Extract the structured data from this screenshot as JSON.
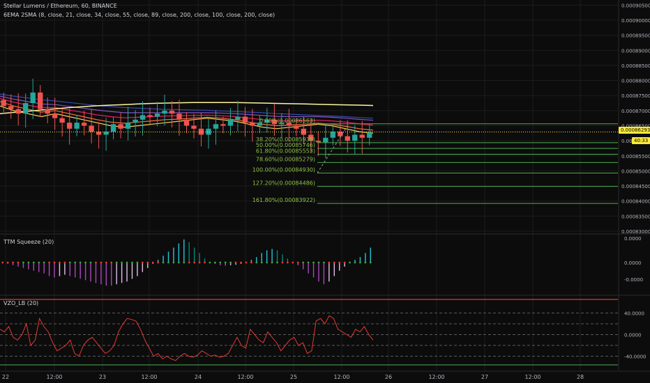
{
  "header": {
    "symbol_line": "Stellar Lumens / Ethereum, 60, BINANCE",
    "study_line": "6EMA 2SMA (8, close, 21, close, 34, close, 55, close, 89, close, 200, close, 100, close, 200, close)"
  },
  "panes": {
    "squeeze_label": "TTM Squeeze (20)",
    "vzo_label": "VZO_LB (20)"
  },
  "tags": {
    "last_price": "0.00086293",
    "countdown": "40:33"
  },
  "colors": {
    "background": "#0c0c0c",
    "grid": "#1c1c1c",
    "up_candle": "#26a69a",
    "down_candle": "#ef5350",
    "fib_line": "#4caf50",
    "fib_text": "#8bc34a",
    "price_tag_bg": "#ffeb3b",
    "vzo_line": "#e53935"
  },
  "chart_data": [
    {
      "type": "candlestick",
      "title": "Stellar Lumens / Ethereum, 60, BINANCE",
      "price_axis": [
        "0.00090500",
        "0.00090000",
        "0.00089500",
        "0.00089000",
        "0.00088500",
        "0.00088000",
        "0.00087500",
        "0.00087000",
        "0.00086500",
        "0.00086000",
        "0.00085500",
        "0.00085000",
        "0.00084500",
        "0.00084000",
        "0.00083500",
        "0.00083000"
      ],
      "time_axis": [
        "22",
        "12:00",
        "23",
        "12:00",
        "24",
        "12:00",
        "25",
        "12:00",
        "26",
        "12:00",
        "27",
        "12:00",
        "28"
      ],
      "ylim": [
        0.00083,
        0.000906
      ],
      "last_price": 0.00086293,
      "fib_levels": [
        {
          "label": "0.00%(0.00086563)",
          "value": 0.00086563
        },
        {
          "label": "38.20%(0.00085938)",
          "value": 0.00085938
        },
        {
          "label": "50.00%(0.00085746)",
          "value": 0.00085746
        },
        {
          "label": "61.80%(0.00085553)",
          "value": 0.00085553
        },
        {
          "label": "78.60%(0.00085279)",
          "value": 0.00085279
        },
        {
          "label": "100.00%(0.00084930)",
          "value": 0.0008493
        },
        {
          "label": "127.20%(0.00084486)",
          "value": 0.00084486
        },
        {
          "label": "161.80%(0.00083922)",
          "value": 0.00083922
        }
      ],
      "close_series": [
        0.0008715,
        0.0008705,
        0.000869,
        0.0008725,
        0.000876,
        0.0008705,
        0.000869,
        0.0008675,
        0.000866,
        0.000864,
        0.000866,
        0.000865,
        0.000863,
        0.000862,
        0.000863,
        0.0008655,
        0.000864,
        0.000866,
        0.000867,
        0.0008685,
        0.000868,
        0.000869,
        0.00087,
        0.000869,
        0.000867,
        0.000865,
        0.000864,
        0.000862,
        0.000864,
        0.0008655,
        0.000865,
        0.000867,
        0.000868,
        0.000866,
        0.000865,
        0.000866,
        0.000867,
        0.0008655,
        0.000866,
        0.000865,
        0.000864,
        0.000862,
        0.00086,
        0.0008595,
        0.000861,
        0.000863,
        0.0008615,
        0.00086,
        0.000862,
        0.000861,
        0.000863
      ],
      "ema_series": [
        {
          "name": "EMA 8",
          "color": "#ffd54f",
          "values": [
            0.0008715,
            0.00087,
            0.000869,
            0.000868,
            0.000869,
            0.000868,
            0.000867,
            0.000866,
            0.000865,
            0.0008645,
            0.000865,
            0.0008655,
            0.000866,
            0.0008665,
            0.000867,
            0.0008675,
            0.000867,
            0.0008665,
            0.0008655,
            0.0008645,
            0.000864,
            0.0008645,
            0.000865,
            0.0008655,
            0.000865,
            0.000864,
            0.000863,
            0.0008625
          ]
        },
        {
          "name": "EMA 21",
          "color": "#ff7043",
          "values": [
            0.000873,
            0.0008715,
            0.0008705,
            0.0008695,
            0.00087,
            0.000869,
            0.000868,
            0.000867,
            0.0008662,
            0.0008658,
            0.0008662,
            0.0008666,
            0.000867,
            0.0008672,
            0.0008675,
            0.0008678,
            0.0008675,
            0.000867,
            0.0008662,
            0.0008655,
            0.000865,
            0.0008652,
            0.0008655,
            0.0008658,
            0.0008655,
            0.0008648,
            0.000864,
            0.0008635
          ]
        },
        {
          "name": "EMA 34",
          "color": "#e91e63",
          "values": [
            0.000874,
            0.0008728,
            0.0008718,
            0.000871,
            0.000871,
            0.0008702,
            0.0008694,
            0.0008686,
            0.000868,
            0.0008676,
            0.0008678,
            0.000868,
            0.0008682,
            0.0008683,
            0.0008684,
            0.0008685,
            0.0008683,
            0.000868,
            0.0008675,
            0.000867,
            0.0008666,
            0.0008666,
            0.0008667,
            0.0008668,
            0.0008666,
            0.0008662,
            0.0008656,
            0.0008652
          ]
        },
        {
          "name": "EMA 55",
          "color": "#7e57c2",
          "values": [
            0.0008748,
            0.0008738,
            0.000873,
            0.0008722,
            0.000872,
            0.0008714,
            0.0008708,
            0.0008702,
            0.0008697,
            0.0008693,
            0.0008693,
            0.0008693,
            0.0008693,
            0.0008693,
            0.0008693,
            0.0008693,
            0.0008692,
            0.000869,
            0.0008687,
            0.0008684,
            0.0008681,
            0.000868,
            0.000868,
            0.000868,
            0.0008678,
            0.0008675,
            0.0008671,
            0.0008668
          ]
        },
        {
          "name": "EMA 89",
          "color": "#3949ab",
          "values": [
            0.0008755,
            0.0008748,
            0.0008742,
            0.0008736,
            0.0008732,
            0.0008727,
            0.0008722,
            0.0008717,
            0.0008713,
            0.000871,
            0.0008708,
            0.0008706,
            0.0008704,
            0.0008703,
            0.0008702,
            0.0008701,
            0.0008699,
            0.0008697,
            0.0008695,
            0.0008693,
            0.000869,
            0.0008688,
            0.0008686,
            0.0008684,
            0.0008682,
            0.000868,
            0.0008677,
            0.0008675
          ]
        },
        {
          "name": "EMA 200",
          "color": "#fff59d",
          "values": [
            0.000869,
            0.0008694,
            0.0008698,
            0.0008702,
            0.0008706,
            0.000871,
            0.0008713,
            0.0008716,
            0.0008718,
            0.000872,
            0.0008722,
            0.0008724,
            0.0008725,
            0.0008726,
            0.0008727,
            0.0008727,
            0.0008727,
            0.0008727,
            0.0008726,
            0.0008725,
            0.0008724,
            0.0008723,
            0.0008722,
            0.0008721,
            0.000872,
            0.0008719,
            0.0008718,
            0.0008717
          ]
        }
      ]
    },
    {
      "type": "bar",
      "title": "TTM Squeeze (20)",
      "y_ticks": [
        "0.0000",
        "0.0000",
        "-0.0000"
      ],
      "values": [
        0.0,
        -0.05,
        -0.1,
        -0.15,
        -0.2,
        -0.25,
        -0.3,
        -0.35,
        -0.4,
        -0.5,
        -0.55,
        -0.5,
        -0.45,
        -0.5,
        -0.55,
        -0.6,
        -0.65,
        -0.7,
        -0.75,
        -0.8,
        -0.85,
        -0.85,
        -0.8,
        -0.75,
        -0.7,
        -0.6,
        -0.5,
        -0.35,
        -0.2,
        -0.05,
        0.1,
        0.25,
        0.4,
        0.55,
        0.7,
        0.85,
        0.75,
        0.55,
        0.35,
        0.15,
        0.0,
        -0.05,
        -0.1,
        -0.12,
        -0.1,
        -0.08,
        -0.05,
        0.0,
        0.1,
        0.2,
        0.35,
        0.45,
        0.5,
        0.45,
        0.3,
        0.15,
        0.0,
        -0.1,
        -0.25,
        -0.4,
        -0.55,
        -0.7,
        -0.8,
        -0.7,
        -0.5,
        -0.3,
        -0.15,
        0.0,
        0.1,
        0.2,
        0.35,
        0.55
      ],
      "ylim": [
        -1.0,
        1.0
      ]
    },
    {
      "type": "line",
      "title": "VZO_LB (20)",
      "y_ticks": [
        "40.0000",
        "0.0000",
        "-40.0000"
      ],
      "values": [
        10,
        5,
        15,
        -5,
        -10,
        0,
        20,
        -20,
        -10,
        30,
        15,
        5,
        -15,
        -30,
        -25,
        -20,
        -10,
        -35,
        -40,
        -20,
        -10,
        -5,
        -15,
        -25,
        -35,
        -30,
        -20,
        5,
        20,
        30,
        28,
        25,
        10,
        -10,
        -25,
        -40,
        -35,
        -45,
        -40,
        -45,
        -48,
        -40,
        -35,
        -40,
        -42,
        -38,
        -30,
        -35,
        -40,
        -38,
        -42,
        -40,
        -35,
        -20,
        -5,
        -20,
        -25,
        10,
        0,
        -10,
        -15,
        5,
        -5,
        -15,
        -30,
        -20,
        -10,
        -5,
        -20,
        -15,
        -35,
        -30,
        25,
        30,
        20,
        35,
        30,
        10,
        5,
        0,
        -5,
        10,
        5,
        15,
        0,
        -10
      ],
      "ylim": [
        -60,
        60
      ]
    }
  ]
}
